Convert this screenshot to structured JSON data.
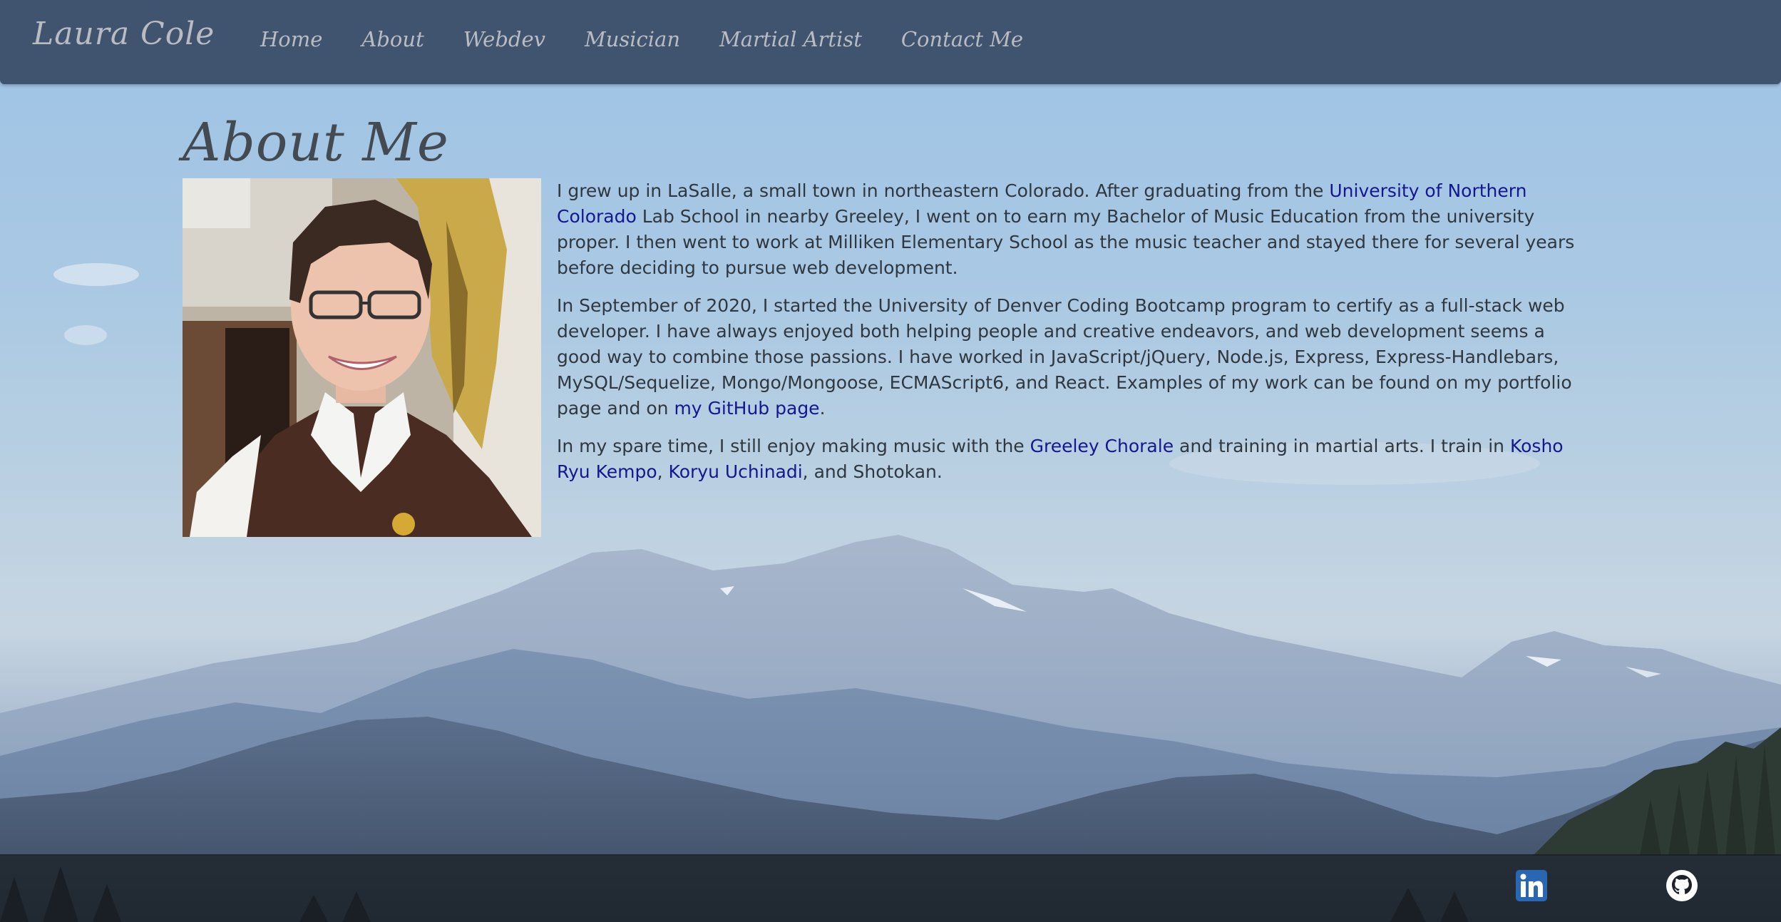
{
  "navbar": {
    "brand": "Laura Cole",
    "links": [
      "Home",
      "About",
      "Webdev",
      "Musician",
      "Martial Artist",
      "Contact Me"
    ]
  },
  "main": {
    "title": "About Me",
    "paragraphs": [
      {
        "p1_a": "I grew up in LaSalle, a small town in northeastern Colorado. After graduating from the ",
        "p1_link": "University of Northern Colorado",
        "p1_b": " Lab School in nearby Greeley, I went on to earn my Bachelor of Music Education from the university proper. I then went to work at Milliken Elementary School as the music teacher and stayed there for several years before deciding to pursue web development."
      },
      {
        "p2_a": "In September of 2020, I started the University of Denver Coding Bootcamp program to certify as a full-stack web developer. I have always enjoyed both helping people and creative endeavors, and web development seems a good way to combine those passions. I have worked in JavaScript/jQuery, Node.js, Express, Express-Handlebars, MySQL/Sequelize, Mongo/Mongoose, ECMAScript6, and React. Examples of my work can be found on my portfolio page and on ",
        "p2_link": "my GitHub page",
        "p2_b": "."
      },
      {
        "p3_a": "In my spare time, I still enjoy making music with the ",
        "p3_link1": "Greeley Chorale",
        "p3_b": " and training in martial arts. I train in ",
        "p3_link2": "Kosho Ryu Kempo",
        "p3_c": ", ",
        "p3_link3": "Koryu Uchinadi",
        "p3_d": ", and Shotokan."
      }
    ]
  },
  "footer": {
    "icons": [
      "linkedin-icon",
      "github-icon"
    ]
  },
  "colors": {
    "navbar_bg": "#3e516a",
    "link": "#14178f",
    "text": "#2f3840",
    "linkedin": "#2a67b2"
  }
}
